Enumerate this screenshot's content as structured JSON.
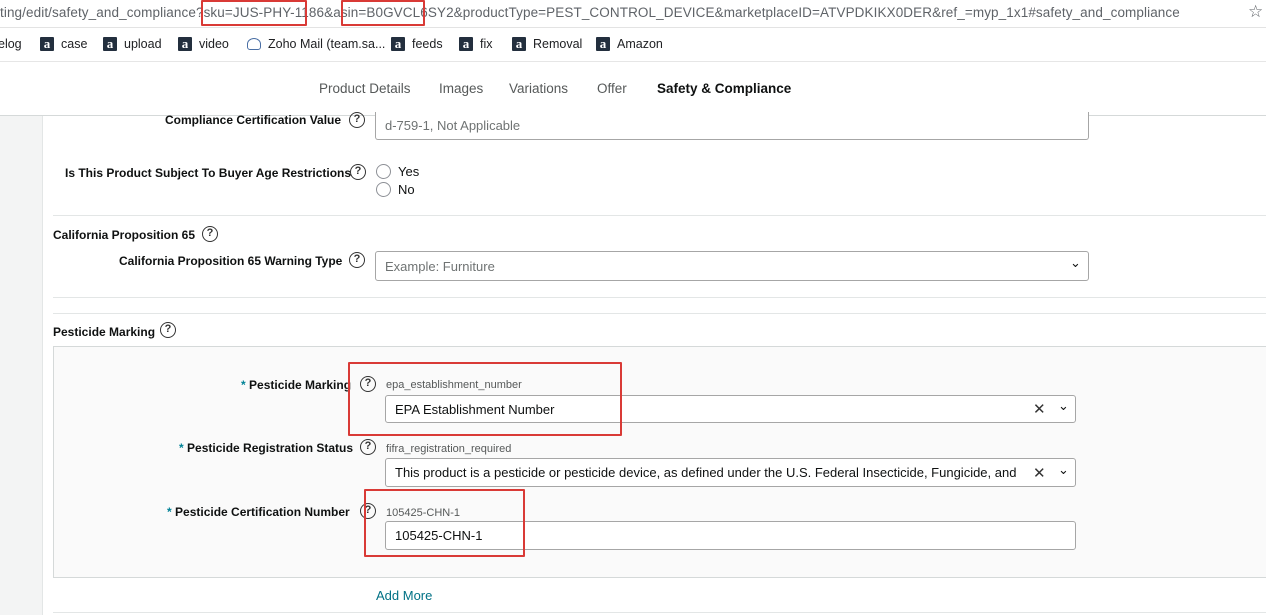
{
  "browser": {
    "url": "ting/edit/safety_and_compliance?sku=JUS-PHY-1186&asin=B0GVCL6SY2&productType=PEST_CONTROL_DEVICE&marketplaceID=ATVPDKIKX0DER&ref_=myp_1x1#safety_and_compliance",
    "star_icon": "star-outline-icon"
  },
  "bookmarks": [
    {
      "label": "elog",
      "icon": "none"
    },
    {
      "label": "case",
      "icon": "amazon-icon"
    },
    {
      "label": "upload",
      "icon": "amazon-icon"
    },
    {
      "label": "video",
      "icon": "amazon-icon"
    },
    {
      "label": "Zoho Mail (team.sa...",
      "icon": "zoho-mail-icon"
    },
    {
      "label": "feeds",
      "icon": "amazon-icon"
    },
    {
      "label": "fix",
      "icon": "amazon-icon"
    },
    {
      "label": "Removal",
      "icon": "amazon-icon"
    },
    {
      "label": "Amazon",
      "icon": "amazon-icon"
    }
  ],
  "tabs": [
    {
      "label": "Product Details",
      "active": false
    },
    {
      "label": "Images",
      "active": false
    },
    {
      "label": "Variations",
      "active": false
    },
    {
      "label": "Offer",
      "active": false
    },
    {
      "label": "Safety & Compliance",
      "active": true
    }
  ],
  "accent_color": "#008296",
  "form": {
    "compliance_cert": {
      "label": "Compliance Certification Value",
      "value": "d-759-1, Not Applicable"
    },
    "age_restrictions": {
      "label": "Is This Product Subject To Buyer Age Restrictions",
      "options": [
        "Yes",
        "No"
      ]
    },
    "prop65": {
      "section_title": "California Proposition 65",
      "warning_type_label": "California Proposition 65 Warning Type",
      "warning_type_placeholder": "Example: Furniture"
    },
    "pesticide": {
      "section_title": "Pesticide Marking",
      "marking": {
        "required_star": "*",
        "label": "Pesticide Marking",
        "hint": "epa_establishment_number",
        "value": "EPA Establishment Number"
      },
      "registration": {
        "required_star": "*",
        "label": "Pesticide Registration Status",
        "hint": "fifra_registration_required",
        "value": "This product is a pesticide or pesticide device, as defined under the U.S. Federal Insecticide, Fungicide, and"
      },
      "certification": {
        "required_star": "*",
        "label": "Pesticide Certification Number",
        "hint": "105425-CHN-1",
        "value": "105425-CHN-1"
      },
      "add_more": "Add More"
    }
  },
  "help_symbol": "?",
  "chevron_symbol": "⌄",
  "clear_symbol": "✕"
}
